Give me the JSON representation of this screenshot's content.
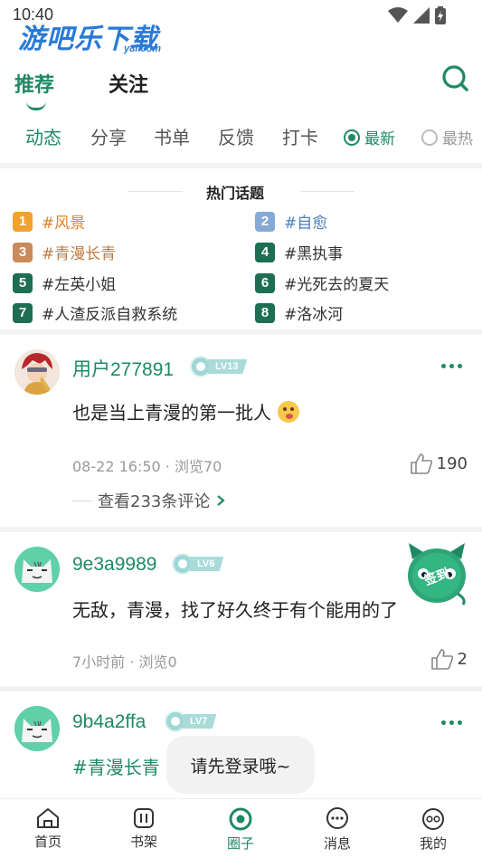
{
  "status_bar": {
    "time": "10:40"
  },
  "watermark": {
    "text": "游吧乐下载",
    "sub": "y8l.com"
  },
  "header": {
    "tabs": [
      {
        "label": "推荐",
        "active": true
      },
      {
        "label": "关注",
        "active": false
      }
    ],
    "search_icon": "search-icon"
  },
  "sub_tabs": [
    "动态",
    "分享",
    "书单",
    "反馈",
    "打卡"
  ],
  "sort": {
    "newest": "最新",
    "hottest": "最热",
    "selected": "最新"
  },
  "hot_topics": {
    "title": "热门话题",
    "items": [
      {
        "rank": "1",
        "text": "#风景",
        "color": "#f2a12e",
        "text_color": "#e0822a"
      },
      {
        "rank": "2",
        "text": "#自愈",
        "color": "#86a9d6",
        "text_color": "#4a7fbf"
      },
      {
        "rank": "3",
        "text": "#青漫长青",
        "color": "#c98a5a",
        "text_color": "#c07a40"
      },
      {
        "rank": "4",
        "text": "#黑执事",
        "color": "#1e6e52",
        "text_color": "#333333"
      },
      {
        "rank": "5",
        "text": "#左英小姐",
        "color": "#1e6e52",
        "text_color": "#333333"
      },
      {
        "rank": "6",
        "text": "#光死去的夏天",
        "color": "#1e6e52",
        "text_color": "#333333"
      },
      {
        "rank": "7",
        "text": "#人渣反派自救系统",
        "color": "#1e6e52",
        "text_color": "#333333"
      },
      {
        "rank": "8",
        "text": "#洛冰河",
        "color": "#1e6e52",
        "text_color": "#333333"
      }
    ]
  },
  "posts": [
    {
      "username": "用户277891",
      "level": "LV13",
      "body": "也是当上青漫的第一批人",
      "meta": "08-22 16:50 · 浏览70",
      "likes": "190",
      "comments": "查看233条评论"
    },
    {
      "username": "9e3a9989",
      "level": "LV6",
      "body": "无敌，青漫，找了好久终于有个能用的了",
      "meta": "7小时前 · 浏览0",
      "likes": "2"
    },
    {
      "username": "9b4a2ffa",
      "level": "LV7",
      "body": "#青漫长青"
    }
  ],
  "toast": "请先登录哦~",
  "float_badge": {
    "text": "签到"
  },
  "bottom_nav": [
    {
      "label": "首页",
      "icon": "home-icon"
    },
    {
      "label": "书架",
      "icon": "bookshelf-icon"
    },
    {
      "label": "圈子",
      "icon": "circle-icon",
      "active": true
    },
    {
      "label": "消息",
      "icon": "message-icon"
    },
    {
      "label": "我的",
      "icon": "profile-icon"
    }
  ],
  "colors": {
    "accent": "#1e8a63",
    "divider": "#f2f2f2"
  }
}
